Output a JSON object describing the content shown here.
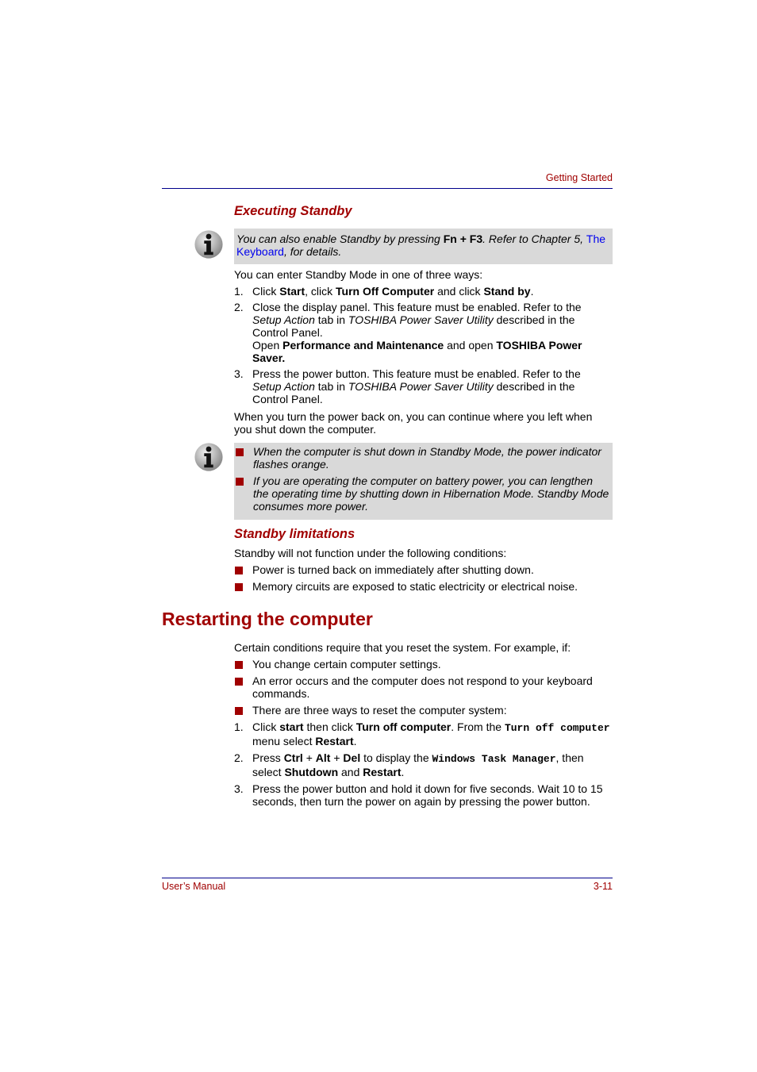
{
  "header": {
    "section": "Getting Started"
  },
  "executing_standby": {
    "title": "Executing Standby",
    "note": {
      "icon": "info-icon",
      "t1": "You can also enable Standby by pressing ",
      "key": "Fn + F3",
      "t2": ". Refer to Chapter 5, ",
      "link": "The Keyboard",
      "t3": ", for details."
    },
    "intro": "You can enter Standby Mode in one of three ways:",
    "steps": [
      {
        "num": "1.",
        "a": "Click ",
        "b1": "Start",
        "c": ", click ",
        "b2": "Turn Off Computer",
        "d": " and click ",
        "b3": "Stand by",
        "e": "."
      },
      {
        "num": "2.",
        "a": "Close the display panel. This feature must be enabled. Refer to the ",
        "i1": "Setup Action",
        "b": " tab in ",
        "i2": "TOSHIBA Power Saver Utility",
        "c": " described in the Control Panel.",
        "d": "Open ",
        "b1": "Performance and Maintenance",
        "e": " and open ",
        "b2": "TOSHIBA Power Saver."
      },
      {
        "num": "3.",
        "a": "Press the power button. This feature must be enabled. Refer to the ",
        "i1": "Setup Action",
        "b": " tab in ",
        "i2": "TOSHIBA Power Saver Utility",
        "c": " described in the Control Panel."
      }
    ],
    "outro": "When you turn the power back on, you can continue where you left when you shut down the computer.",
    "note2": {
      "icon": "info-icon",
      "items": [
        "When the computer is shut down in Standby Mode, the power indicator flashes orange.",
        "If you are operating the computer on battery power, you can lengthen the operating time by shutting down in Hibernation Mode. Standby Mode consumes more power."
      ]
    }
  },
  "standby_limitations": {
    "title": "Standby limitations",
    "intro": "Standby will not function under the following conditions:",
    "items": [
      "Power is turned back on immediately after shutting down.",
      "Memory circuits are exposed to static electricity or electrical noise."
    ]
  },
  "restarting": {
    "title": "Restarting the computer",
    "intro": "Certain conditions require that you reset the system. For example, if:",
    "items": [
      "You change certain computer settings.",
      "An error occurs and the computer does not respond to your keyboard commands.",
      "There are three ways to reset the computer system:"
    ],
    "steps": [
      {
        "num": "1.",
        "a": "Click ",
        "b1": "start",
        "c": " then click ",
        "b2": "Turn off computer",
        "d": ". From the ",
        "m1": "Turn off computer",
        "e": "  menu select ",
        "b3": "Restart",
        "f": "."
      },
      {
        "num": "2.",
        "a": "Press ",
        "b1": "Ctrl",
        "p1": " + ",
        "b2": "Alt",
        "p2": " + ",
        "b3": "Del",
        "c": " to display the ",
        "m1": "Windows Task Manager",
        "d": ", then select ",
        "b4": "Shutdown",
        "e": " and ",
        "b5": "Restart",
        "f": "."
      },
      {
        "num": "3.",
        "a": "Press the power button and hold it down for five seconds. Wait 10 to 15 seconds, then turn the power on again by pressing the power button."
      }
    ]
  },
  "footer": {
    "left": "User’s Manual",
    "right": "3-11"
  }
}
